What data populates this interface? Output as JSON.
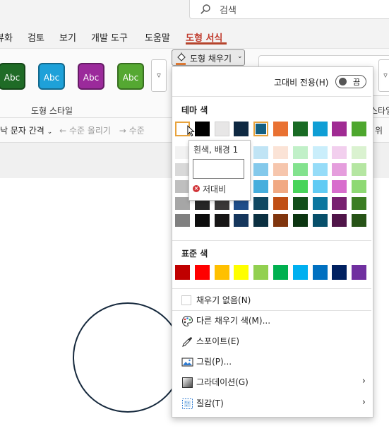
{
  "search": {
    "placeholder": "검색",
    "icon": "search-icon"
  },
  "tabs": [
    {
      "label": "뷰화"
    },
    {
      "label": "검토"
    },
    {
      "label": "보기"
    },
    {
      "label": "개발 도구"
    },
    {
      "label": "도움말"
    },
    {
      "label": "도형 서식",
      "active": true
    }
  ],
  "ribbon": {
    "shape_styles": [
      {
        "label": "Abc",
        "color": "#1f6b26"
      },
      {
        "label": "Abc",
        "color": "#1ea1d9"
      },
      {
        "label": "Abc",
        "color": "#9b2a9b"
      },
      {
        "label": "Abc",
        "color": "#55a832"
      }
    ],
    "more_glyph": "▿",
    "group_label": "도형 스타일",
    "row2": {
      "text_spacing": "문자 간격",
      "text_spacing_prefix": "낙",
      "promote": "수준 올리기",
      "demote": "수준"
    },
    "fill_button": {
      "label": "도형 채우기",
      "accent": "#e07a34"
    },
    "right_group_label": "스타일",
    "right_group_label2": "위"
  },
  "dropdown": {
    "high_contrast": {
      "label": "고대비 전용(H)",
      "toggle_text": "끔"
    },
    "theme_title": "테마 색",
    "theme_colors": [
      "#ffffff",
      "#000000",
      "#e7e6e6",
      "#0e2841",
      "#156082",
      "#e97132",
      "#196b24",
      "#0f9ed5",
      "#a02b93",
      "#4ea72e"
    ],
    "tint_columns": [
      [
        "#f2f2f2",
        "#d9d9d9",
        "#bfbfbf",
        "#a6a6a6",
        "#808080"
      ],
      [
        "#7f7f7f",
        "#595959",
        "#404040",
        "#262626",
        "#0d0d0d"
      ],
      [
        "#d0cece",
        "#aeaaaa",
        "#757070",
        "#3a3838",
        "#171616"
      ],
      [
        "#c2d7f0",
        "#8db2e0",
        "#5a8cd0",
        "#1f4e8a",
        "#15365c"
      ],
      [
        "#c0e4f5",
        "#84c9eb",
        "#46aedd",
        "#104862",
        "#0b3041"
      ],
      [
        "#fbe3d6",
        "#f6c6ad",
        "#f1a983",
        "#c04f15",
        "#80350e"
      ],
      [
        "#c1f0c8",
        "#83e28e",
        "#47d459",
        "#124f1a",
        "#0c3511"
      ],
      [
        "#caeefb",
        "#96dcf8",
        "#61cbf4",
        "#0b769f",
        "#074f6a"
      ],
      [
        "#f2cfee",
        "#e59edd",
        "#d86dcd",
        "#782070",
        "#501549"
      ],
      [
        "#daf2d0",
        "#b5e6a2",
        "#8ed973",
        "#3b7d23",
        "#275317"
      ]
    ],
    "standard_title": "표준 색",
    "standard_colors": [
      "#c00000",
      "#ff0000",
      "#ffc000",
      "#ffff00",
      "#92d050",
      "#00b050",
      "#00b0f0",
      "#0070c0",
      "#002060",
      "#7030a0"
    ],
    "tooltip": {
      "title": "흰색, 배경 1",
      "warning": "저대비"
    },
    "items": [
      {
        "label": "채우기 없음(N)",
        "icon": "no-fill-icon"
      },
      {
        "label": "다른 채우기 색(M)...",
        "icon": "palette-icon"
      },
      {
        "label": "스포이트(E)",
        "icon": "eyedropper-icon"
      },
      {
        "label": "그림(P)...",
        "icon": "picture-icon"
      },
      {
        "label": "그라데이션(G)",
        "icon": "gradient-icon",
        "submenu": true
      },
      {
        "label": "질감(T)",
        "icon": "texture-icon",
        "submenu": true
      }
    ],
    "submenu_glyph": "›"
  }
}
